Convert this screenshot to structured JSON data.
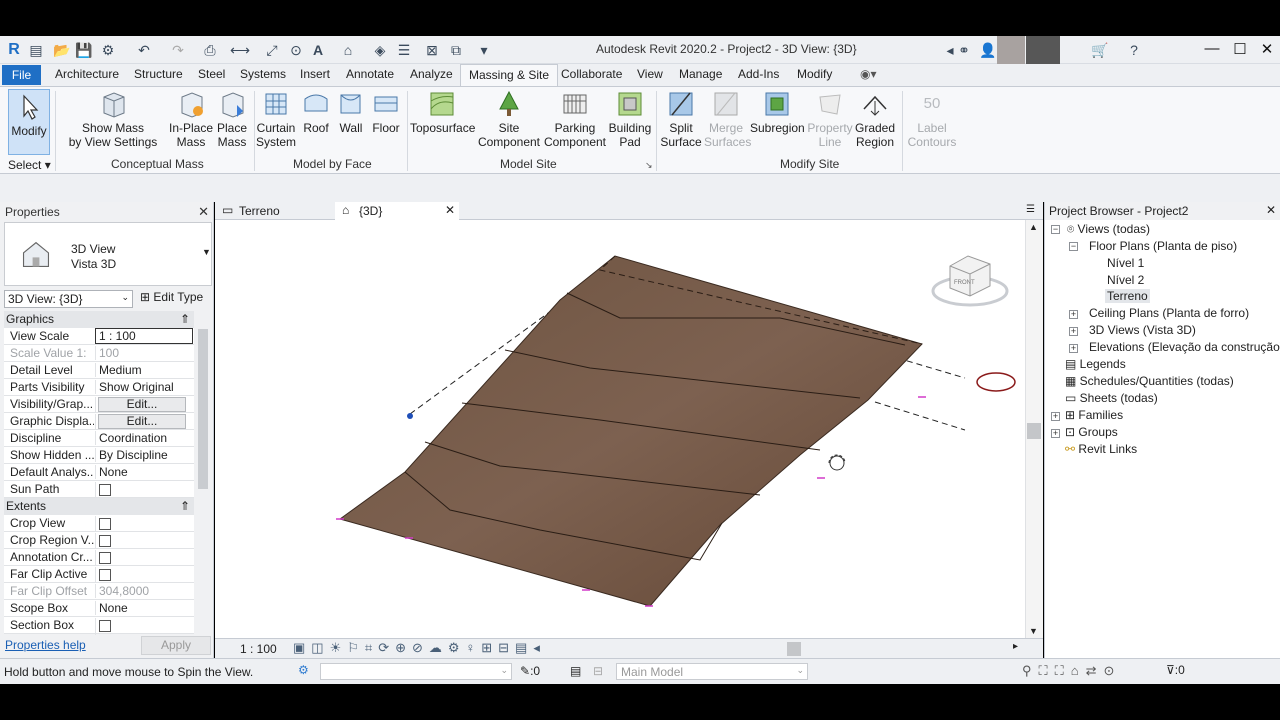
{
  "app": {
    "title": "Autodesk Revit 2020.2 - Project2 - 3D View: {3D}"
  },
  "ribbon": {
    "tabs": [
      "File",
      "Architecture",
      "Structure",
      "Steel",
      "Systems",
      "Insert",
      "Annotate",
      "Analyze",
      "Massing & Site",
      "Collaborate",
      "View",
      "Manage",
      "Add-Ins",
      "Modify"
    ],
    "active_tab": "Massing & Site",
    "select_label": "Select",
    "buttons": {
      "modify": "Modify",
      "show_mass_1": "Show Mass",
      "show_mass_2": "by View Settings",
      "inplace_1": "In-Place",
      "inplace_2": "Mass",
      "place_1": "Place",
      "place_2": "Mass",
      "curtain_1": "Curtain",
      "curtain_2": "System",
      "roof": "Roof",
      "wall": "Wall",
      "floor": "Floor",
      "toposurface": "Toposurface",
      "site_1": "Site",
      "site_2": "Component",
      "parking_1": "Parking",
      "parking_2": "Component",
      "building_1": "Building",
      "building_2": "Pad",
      "split_1": "Split",
      "split_2": "Surface",
      "merge_1": "Merge",
      "merge_2": "Surfaces",
      "subregion": "Subregion",
      "property_1": "Property",
      "property_2": "Line",
      "graded_1": "Graded",
      "graded_2": "Region",
      "label_1": "Label",
      "label_2": "Contours",
      "label_icon": "50"
    },
    "groups": {
      "conceptual": "Conceptual Mass",
      "model_by_face": "Model by Face",
      "model_site": "Model Site",
      "modify_site": "Modify Site"
    }
  },
  "properties": {
    "header": "Properties",
    "type_name_1": "3D View",
    "type_name_2": "Vista 3D",
    "instance_selector": "3D View: {3D}",
    "edit_type": "Edit Type",
    "cat_graphics": "Graphics",
    "cat_extents": "Extents",
    "rows": {
      "view_scale_k": "View Scale",
      "view_scale_v": "1 : 100",
      "scale_value_k": "Scale Value    1:",
      "scale_value_v": "100",
      "detail_level_k": "Detail Level",
      "detail_level_v": "Medium",
      "parts_vis_k": "Parts Visibility",
      "parts_vis_v": "Show Original",
      "vis_graph_k": "Visibility/Grap...",
      "vis_graph_v": "Edit...",
      "graphic_disp_k": "Graphic Displa...",
      "graphic_disp_v": "Edit...",
      "discipline_k": "Discipline",
      "discipline_v": "Coordination",
      "show_hidden_k": "Show Hidden ...",
      "show_hidden_v": "By Discipline",
      "default_anal_k": "Default Analys...",
      "default_anal_v": "None",
      "sun_path_k": "Sun Path",
      "crop_view_k": "Crop View",
      "crop_region_k": "Crop Region V...",
      "annotation_k": "Annotation Cr...",
      "far_clip_active_k": "Far Clip Active",
      "far_clip_offset_k": "Far Clip Offset",
      "far_clip_offset_v": "304,8000",
      "scope_box_k": "Scope Box",
      "scope_box_v": "None",
      "section_box_k": "Section Box"
    },
    "help_link": "Properties help",
    "apply": "Apply"
  },
  "views": {
    "tab1": "Terreno",
    "tab2": "{3D}",
    "scale": "1 : 100",
    "viewcube_label": "FRONT"
  },
  "browser": {
    "header": "Project Browser - Project2",
    "items": {
      "views": "Views (todas)",
      "floor_plans": "Floor Plans (Planta de piso)",
      "nivel1": "Nível 1",
      "nivel2": "Nível 2",
      "terreno": "Terreno",
      "ceiling": "Ceiling Plans (Planta de forro)",
      "views3d": "3D Views (Vista 3D)",
      "elevations": "Elevations (Elevação da construção)",
      "legends": "Legends",
      "schedules": "Schedules/Quantities (todas)",
      "sheets": "Sheets (todas)",
      "families": "Families",
      "groups": "Groups",
      "revit_links": "Revit Links"
    }
  },
  "status": {
    "message": "Hold button and move mouse to Spin the View.",
    "workset_count": ":0",
    "model": "Main Model",
    "filter_count": ":0"
  }
}
